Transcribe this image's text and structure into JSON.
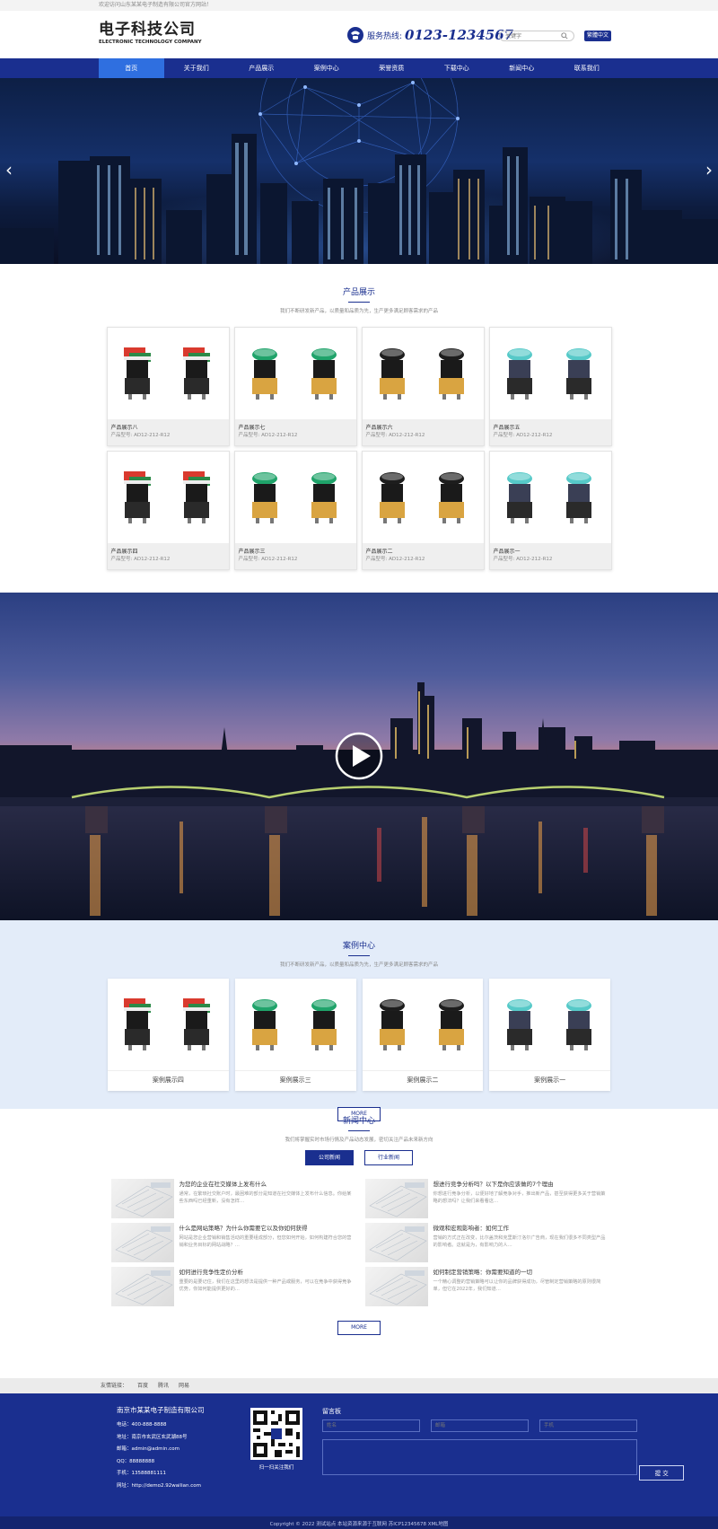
{
  "topbar": {
    "welcome": "欢迎访问山东某某电子制造有限公司官方网站！"
  },
  "header": {
    "logo_cn": "电子科技公司",
    "logo_en": "ELECTRONIC TECHNOLOGY COMPANY",
    "hotline_label": "服务热线:",
    "hotline_number": "0123-1234567",
    "search_placeholder": "关键字",
    "lang_button": "繁體中文"
  },
  "nav": [
    "首页",
    "关于我们",
    "产品展示",
    "案例中心",
    "荣誉资质",
    "下载中心",
    "新闻中心",
    "联系我们"
  ],
  "products": {
    "title": "产品展示",
    "subtitle": "我们不断研发新产品，以质量和品质为先，生产更多满足顾客需求的产品",
    "items": [
      {
        "name": "产品展示八",
        "model": "产品型号: AD12-212-R12",
        "style": "rg"
      },
      {
        "name": "产品展示七",
        "model": "产品型号: AD12-212-R12",
        "style": "green"
      },
      {
        "name": "产品展示六",
        "model": "产品型号: AD12-212-R12",
        "style": "dark"
      },
      {
        "name": "产品展示五",
        "model": "产品型号: AD12-212-R12",
        "style": "cyan"
      },
      {
        "name": "产品展示四",
        "model": "产品型号: AD12-212-R12",
        "style": "rg"
      },
      {
        "name": "产品展示三",
        "model": "产品型号: AD12-212-R12",
        "style": "green"
      },
      {
        "name": "产品展示二",
        "model": "产品型号: AD12-212-R12",
        "style": "dark"
      },
      {
        "name": "产品展示一",
        "model": "产品型号: AD12-212-R12",
        "style": "cyan"
      }
    ]
  },
  "cases": {
    "title": "案例中心",
    "subtitle": "我们不断研发新产品，以质量和品质为先，生产更多满足顾客需求的产品",
    "items": [
      {
        "name": "案例展示四",
        "style": "rg"
      },
      {
        "name": "案例展示三",
        "style": "green"
      },
      {
        "name": "案例展示二",
        "style": "dark"
      },
      {
        "name": "案例展示一",
        "style": "cyan"
      }
    ],
    "more": "MORE"
  },
  "news": {
    "title": "新闻中心",
    "subtitle": "我们将掌握实时市场行情及产品动态发展，密切关注产品未来新方向",
    "tabs": [
      "公司新闻",
      "行业新闻"
    ],
    "items": [
      {
        "title": "为您的企业在社交媒体上发布什么",
        "summary": "通常，在繁琐社交账户时，最困难的部分是知道在社交媒体上发布什么信息。你给某些东西吗已经重新，没有怎样…"
      },
      {
        "title": "想进行竞争分析吗？以下是你应该做的7个理由",
        "summary": "你想进行竞争分析，以便好地了解竞争对手，推出新产品，甚至获得更多关于营销策略的想法吗？让我们来看看这…"
      },
      {
        "title": "什么是网站策略？为什么你需要它以及你如何获得",
        "summary": "网站是您企业营销和销售活动的重要组成部分，但您如何开始，如何构建符合您的营销和业务目标的网站战略？…"
      },
      {
        "title": "微观和宏观影响者：如何工作",
        "summary": "营销的方式正在改变，比尔盖茨和克里斯汀洛尔广告商，现在我们很多不同类型产品的影响者。这就是为，有影响力的人…"
      },
      {
        "title": "如何进行竞争性定价分析",
        "summary": "重要的是要记住，我们在这里的想法是提供一种产品或服务，可以在竞争中获得竞争优势，你如何能提供更好的…"
      },
      {
        "title": "如何制定营销策略：你需要知道的一切",
        "summary": "一个精心调整的营销策略可以让你的品牌获得成功，尽管制定营销策略的原则很简单，但它在2022年，我们知道…"
      }
    ],
    "more": "MORE"
  },
  "links": {
    "label": "友情链接：",
    "items": [
      "百度",
      "腾讯",
      "网易"
    ]
  },
  "footer": {
    "company": "南京市某某电子制造有限公司",
    "lines": [
      "电话：400-888-8888",
      "地址：南京市玄武区玄武湖88号",
      "邮箱：admin@admin.com",
      "QQ：88888888",
      "手机：13588881111",
      "网址：http://demo2.92wailian.com"
    ],
    "qr_caption": "扫一扫关注我们",
    "message_title": "留言板",
    "name_placeholder": "姓名",
    "email_placeholder": "邮箱",
    "phone_placeholder": "手机",
    "submit": "提 交",
    "copyright": "Copyright © 2022 测试站点 本站资源来源于互联网 苏ICP12345678 XML地图"
  },
  "colors": {
    "primary": "#1a2f8f",
    "nav_active": "#2f6fe0",
    "case_bg": "#e3ecf9"
  }
}
